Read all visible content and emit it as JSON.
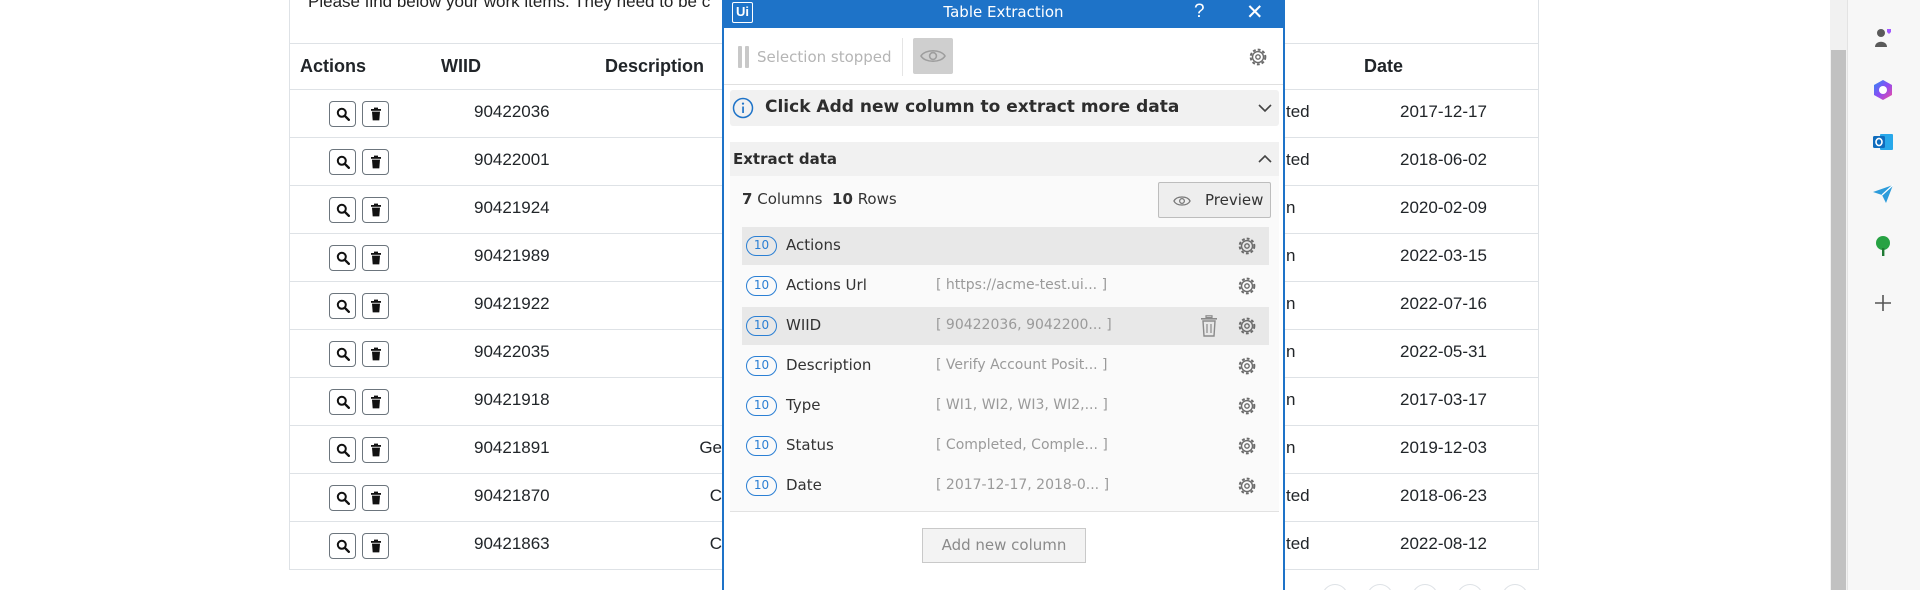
{
  "page": {
    "intro_text": "Please find below your work items. They need to be c",
    "headers": {
      "actions": "Actions",
      "wiid": "WIID",
      "description": "Description",
      "date": "Date"
    },
    "rows": [
      {
        "wiid": "90422036",
        "desc_fragment": "",
        "status_fragment": "ted",
        "date": "2017-12-17"
      },
      {
        "wiid": "90422001",
        "desc_fragment": "",
        "status_fragment": "ted",
        "date": "2018-06-02"
      },
      {
        "wiid": "90421924",
        "desc_fragment": "",
        "status_fragment": "n",
        "date": "2020-02-09"
      },
      {
        "wiid": "90421989",
        "desc_fragment": "",
        "status_fragment": "n",
        "date": "2022-03-15"
      },
      {
        "wiid": "90421922",
        "desc_fragment": "",
        "status_fragment": "n",
        "date": "2022-07-16"
      },
      {
        "wiid": "90422035",
        "desc_fragment": "",
        "status_fragment": "n",
        "date": "2022-05-31"
      },
      {
        "wiid": "90421918",
        "desc_fragment": "",
        "status_fragment": "n",
        "date": "2017-03-17"
      },
      {
        "wiid": "90421891",
        "desc_fragment": "Ge",
        "status_fragment": "n",
        "date": "2019-12-03"
      },
      {
        "wiid": "90421870",
        "desc_fragment": "C",
        "status_fragment": "ted",
        "date": "2018-06-23"
      },
      {
        "wiid": "90421863",
        "desc_fragment": "C",
        "status_fragment": "ted",
        "date": "2022-08-12"
      }
    ],
    "row_icons": [
      "search-icon",
      "trash-icon"
    ]
  },
  "dialog": {
    "logo": "Ui",
    "title": "Table Extraction",
    "help": "?",
    "close": "✕",
    "selection_status": "Selection stopped",
    "info_text": "Click Add new column to extract more data",
    "extract_section": "Extract data",
    "columns_count": "7",
    "columns_label": "Columns",
    "rows_count": "10",
    "rows_label": "Rows",
    "preview_label": "Preview",
    "columns": [
      {
        "count": "10",
        "name": "Actions",
        "sample": ""
      },
      {
        "count": "10",
        "name": "Actions Url",
        "sample": "[ https://acme-test.ui... ]"
      },
      {
        "count": "10",
        "name": "WIID",
        "sample": "[ 90422036, 9042200... ]"
      },
      {
        "count": "10",
        "name": "Description",
        "sample": "[ Verify Account Posit... ]"
      },
      {
        "count": "10",
        "name": "Type",
        "sample": "[ WI1, WI2, WI3, WI2,... ]"
      },
      {
        "count": "10",
        "name": "Status",
        "sample": "[ Completed, Comple... ]"
      },
      {
        "count": "10",
        "name": "Date",
        "sample": "[ 2017-12-17, 2018-0... ]"
      }
    ],
    "add_column_label": "Add new column",
    "accent_color": "#1e73c8"
  },
  "sidebar": {
    "icons": [
      "chess-icon",
      "copilot-icon",
      "outlook-icon",
      "send-icon",
      "tree-icon",
      "plus-icon"
    ]
  }
}
